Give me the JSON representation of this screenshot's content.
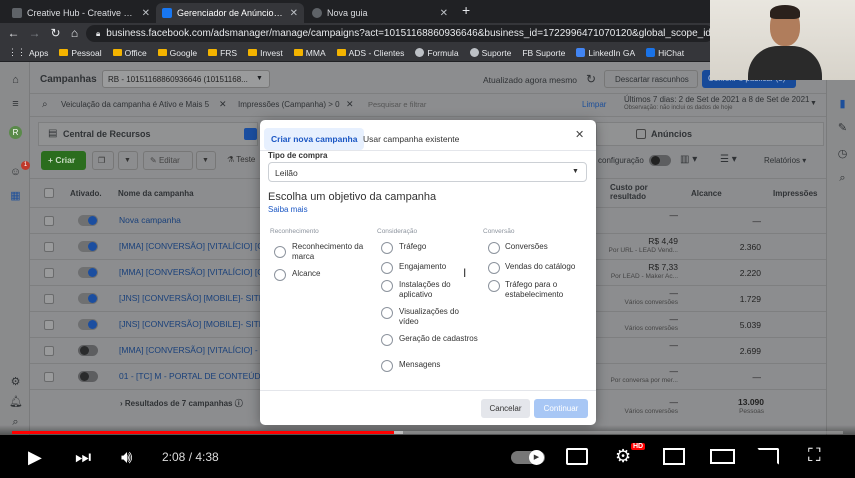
{
  "browser": {
    "tabs": [
      {
        "title": "Creative Hub - Creative Hub | My",
        "active": false
      },
      {
        "title": "Gerenciador de Anúncios - Gere",
        "active": true
      },
      {
        "title": "Nova guia",
        "active": false
      }
    ],
    "new_tab_symbol": "+",
    "url": "business.facebook.com/adsmanager/manage/campaigns?act=10151168860936646&business_id=1722996471070120&global_scope_id=172299647107...",
    "bookmarks": [
      "Apps",
      "Pessoal",
      "Office",
      "Google",
      "FRS",
      "Invest",
      "MMA",
      "ADS - Clientes",
      "Formula",
      "Suporte",
      "FB Suporte",
      "LinkedIn GA",
      "HiChat"
    ]
  },
  "ads_manager": {
    "section_title": "Campanhas",
    "account_selector": "RB - 10151168860936646 (10151168...",
    "updated_status": "Atualizado agora mesmo",
    "discard_drafts": "Descartar rascunhos",
    "publish_button": "Conferir e publicar (3)",
    "filters": {
      "chip1": "Veiculação da campanha é Ativo e Mais 5",
      "chip2": "Impressões (Campanha) > 0",
      "search_placeholder": "Pesquisar e filtrar",
      "clear": "Limpar",
      "date_range": "Últimos 7 dias: 2 de Set de 2021 a 8 de Set de 2021",
      "date_note": "Observação: não inclui os dados de hoje"
    },
    "resource_center": "Central de Recursos",
    "ads_tab": "Anúncios",
    "toolbar": {
      "create": "+ Criar",
      "edit": "Editar",
      "test": "Teste",
      "configuration": "configuração",
      "reports": "Relatórios"
    },
    "table": {
      "headers": {
        "activated": "Ativado.",
        "name": "Nome da campanha",
        "cost_per_result": "Custo por resultado",
        "reach": "Alcance",
        "impressions": "Impressões"
      },
      "rows": [
        {
          "name": "Nova campanha",
          "on": true,
          "cost": "—",
          "cost_sub": "",
          "reach": "—"
        },
        {
          "name": "[MMA] [CONVERSÃO] [VITALÍCIO] [CBO]",
          "on": true,
          "cost": "R$ 4,49",
          "cost_sub": "Por URL - LEAD Vend...",
          "reach": "2.360"
        },
        {
          "name": "[MMA] [CONVERSÃO] [VITALÍCIO] [CBO]",
          "on": true,
          "cost": "R$ 7,33",
          "cost_sub": "Por LEAD - Maker Ac...",
          "reach": "2.220"
        },
        {
          "name": "[JNS] [CONVERSÃO] [MOBILE]- SITE Opt",
          "on": true,
          "cost": "—",
          "cost_sub": "Vários conversões",
          "reach": "1.729"
        },
        {
          "name": "[JNS] [CONVERSÃO] [MOBILE]- SITE Na",
          "on": true,
          "cost": "—",
          "cost_sub": "Vários conversões",
          "reach": "5.039"
        },
        {
          "name": "[MMA] [CONVERSÃO] [VITALÍCIO] - REC",
          "on": false,
          "cost": "—",
          "cost_sub": "",
          "reach": "2.699"
        },
        {
          "name": "01 - [TC] M - PORTAL DE CONTEÚDO - C",
          "on": false,
          "cost": "—",
          "cost_sub": "Por conversa por mer...",
          "reach": "—"
        }
      ],
      "total_label": "Resultados de 7 campanhas",
      "total_cost": "—",
      "total_cost_sub": "Vários conversões",
      "total_reach": "13.090",
      "total_reach_sub": "Pessoas"
    }
  },
  "modal": {
    "tab_new": "Criar nova campanha",
    "tab_existing": "Usar campanha existente",
    "buy_type_label": "Tipo de compra",
    "buy_type_value": "Leilão",
    "objective_title": "Escolha um objetivo da campanha",
    "learn_more": "Saiba mais",
    "columns": {
      "awareness": {
        "title": "Reconhecimento",
        "options": [
          "Reconhecimento da marca",
          "Alcance"
        ]
      },
      "consideration": {
        "title": "Consideração",
        "options": [
          "Tráfego",
          "Engajamento",
          "Instalações do aplicativo",
          "Visualizações do vídeo",
          "Geração de cadastros",
          "Mensagens"
        ]
      },
      "conversion": {
        "title": "Conversão",
        "options": [
          "Conversões",
          "Vendas do catálogo",
          "Tráfego para o estabelecimento"
        ]
      }
    },
    "cancel": "Cancelar",
    "continue": "Continuar"
  },
  "player": {
    "time_current": "2:08",
    "time_total": "4:38",
    "played_fraction": 0.46,
    "buffered_fraction": 0.47,
    "hd_badge": "HD"
  },
  "colors": {
    "accent": "#1877f2",
    "yt_red": "#ff0000",
    "create_green": "#42b72a"
  }
}
